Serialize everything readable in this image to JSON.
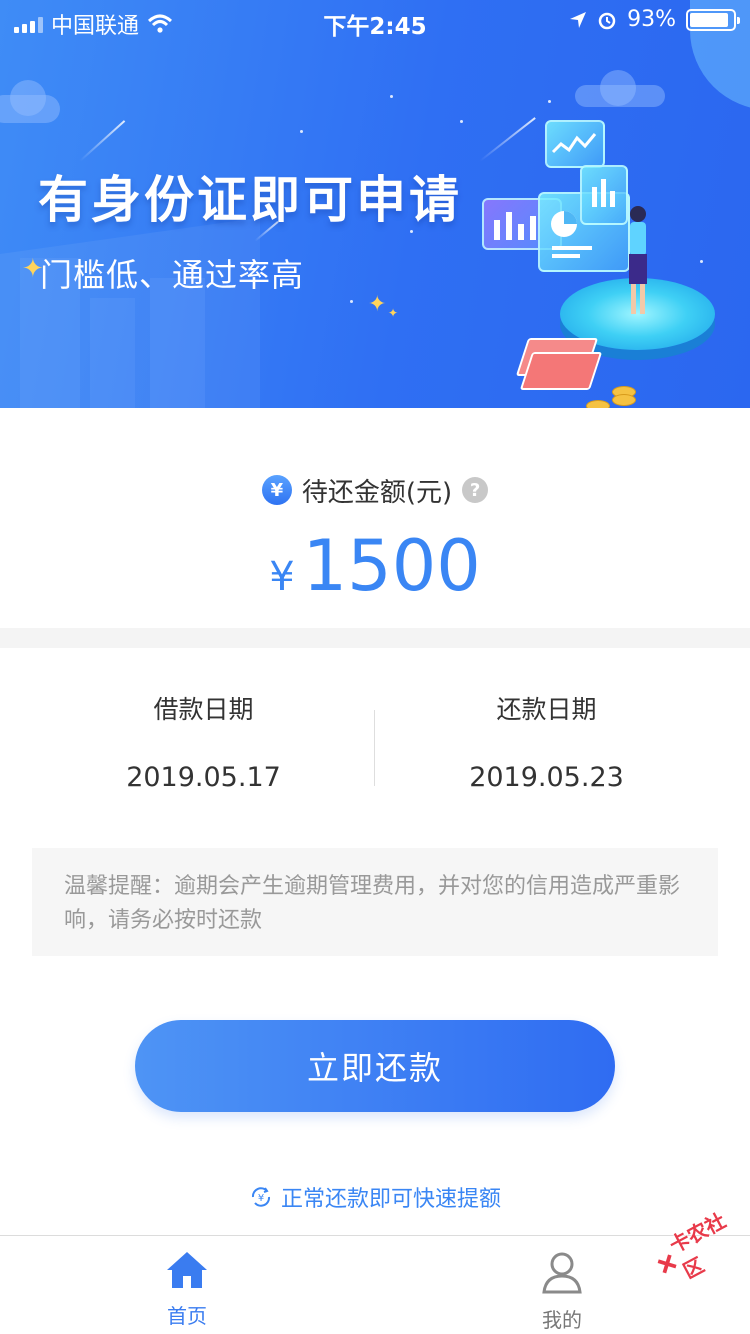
{
  "status_bar": {
    "carrier": "中国联通",
    "time": "下午2:45",
    "battery": "93%"
  },
  "banner": {
    "title": "有身份证即可申请",
    "subtitle": "门槛低、通过率高"
  },
  "amount": {
    "label": "待还金额(元)",
    "currency": "¥",
    "value": "1500"
  },
  "dates": {
    "borrow_label": "借款日期",
    "borrow_value": "2019.05.17",
    "repay_label": "还款日期",
    "repay_value": "2019.05.23"
  },
  "reminder": {
    "text": "温馨提醒：逾期会产生逾期管理费用，并对您的信用造成严重影响，请务必按时还款"
  },
  "actions": {
    "pay_label": "立即还款",
    "tip": "正常还款即可快速提额"
  },
  "tabbar": {
    "home_label": "首页",
    "mine_label": "我的"
  },
  "watermark": {
    "text": "卡农社区"
  },
  "colors": {
    "accent": "#3a86f4",
    "banner": "#2f6ff3"
  }
}
